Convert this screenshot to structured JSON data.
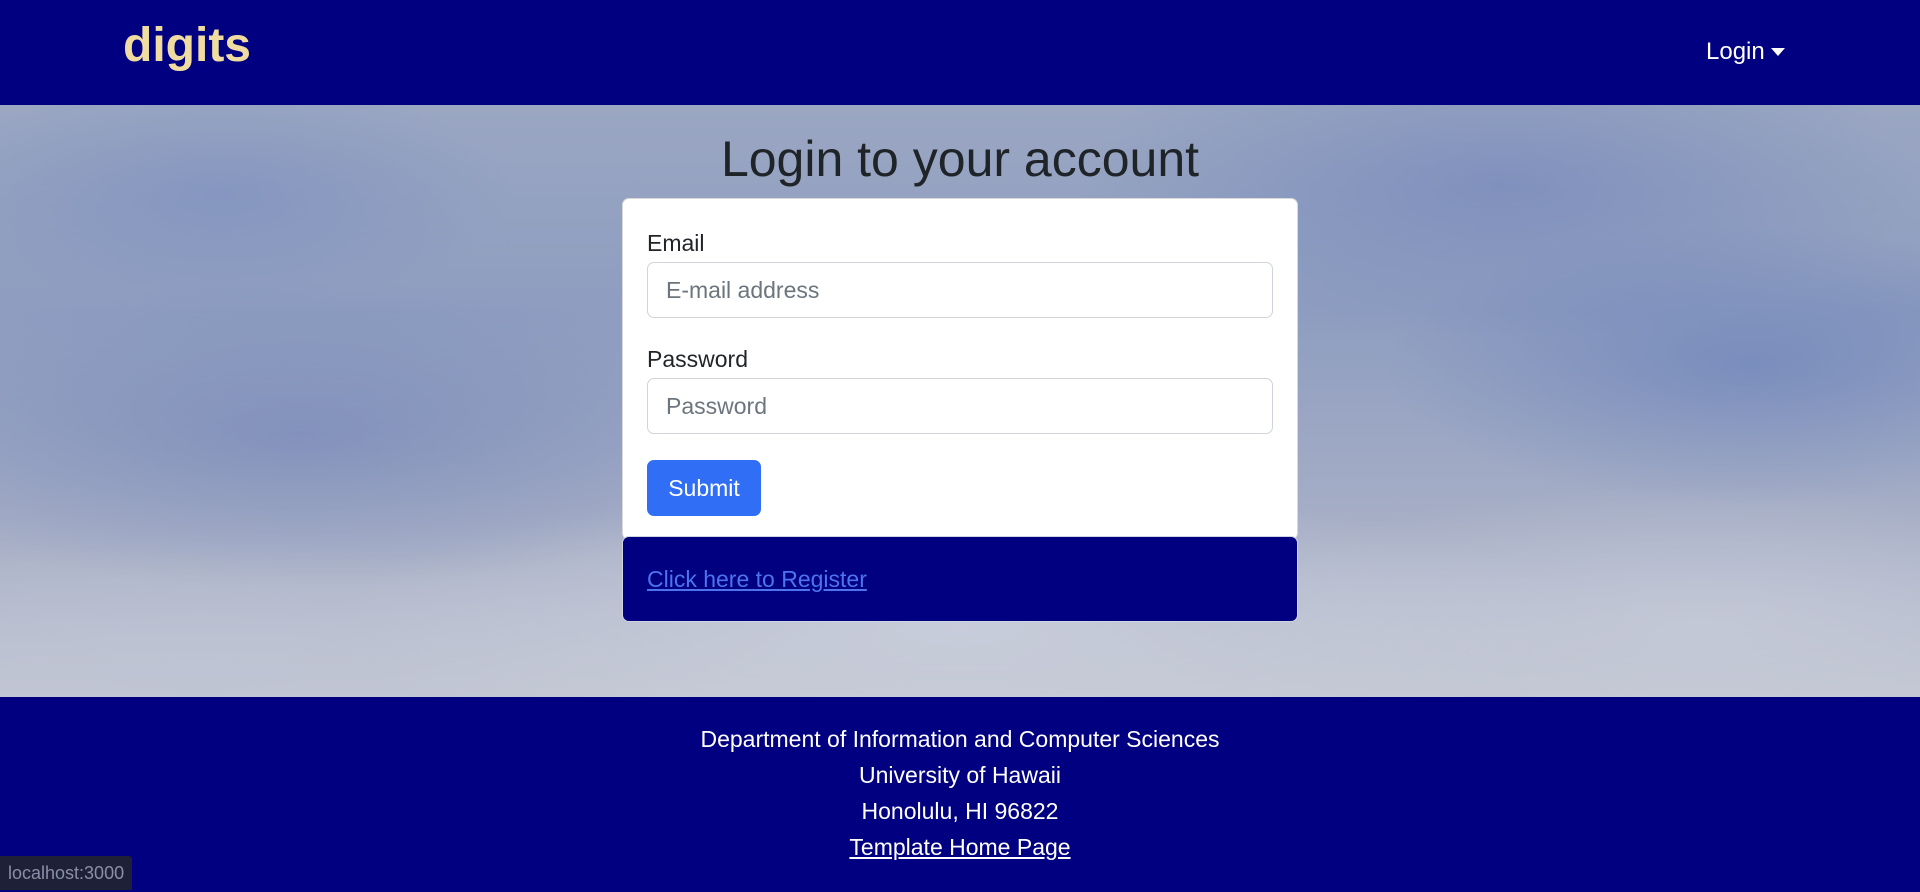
{
  "navbar": {
    "brand": "digits",
    "login_menu": "Login",
    "login_caret_icon": "caret-down-icon",
    "background": "#000080",
    "brand_color": "#f0dca0"
  },
  "main": {
    "title": "Login to your account",
    "form": {
      "email_label": "Email",
      "email_placeholder": "E-mail address",
      "email_value": "",
      "password_label": "Password",
      "password_placeholder": "Password",
      "password_value": "",
      "submit_label": "Submit",
      "submit_color": "#2f6ef5"
    },
    "register": {
      "link_text": "Click here to Register",
      "link_color": "#4d73ee"
    }
  },
  "footer": {
    "line1": "Department of Information and Computer Sciences",
    "line2": "University of Hawaii",
    "line3": "Honolulu, HI 96822",
    "link_text": "Template Home Page"
  },
  "status_bar": {
    "url": "localhost:3000"
  }
}
